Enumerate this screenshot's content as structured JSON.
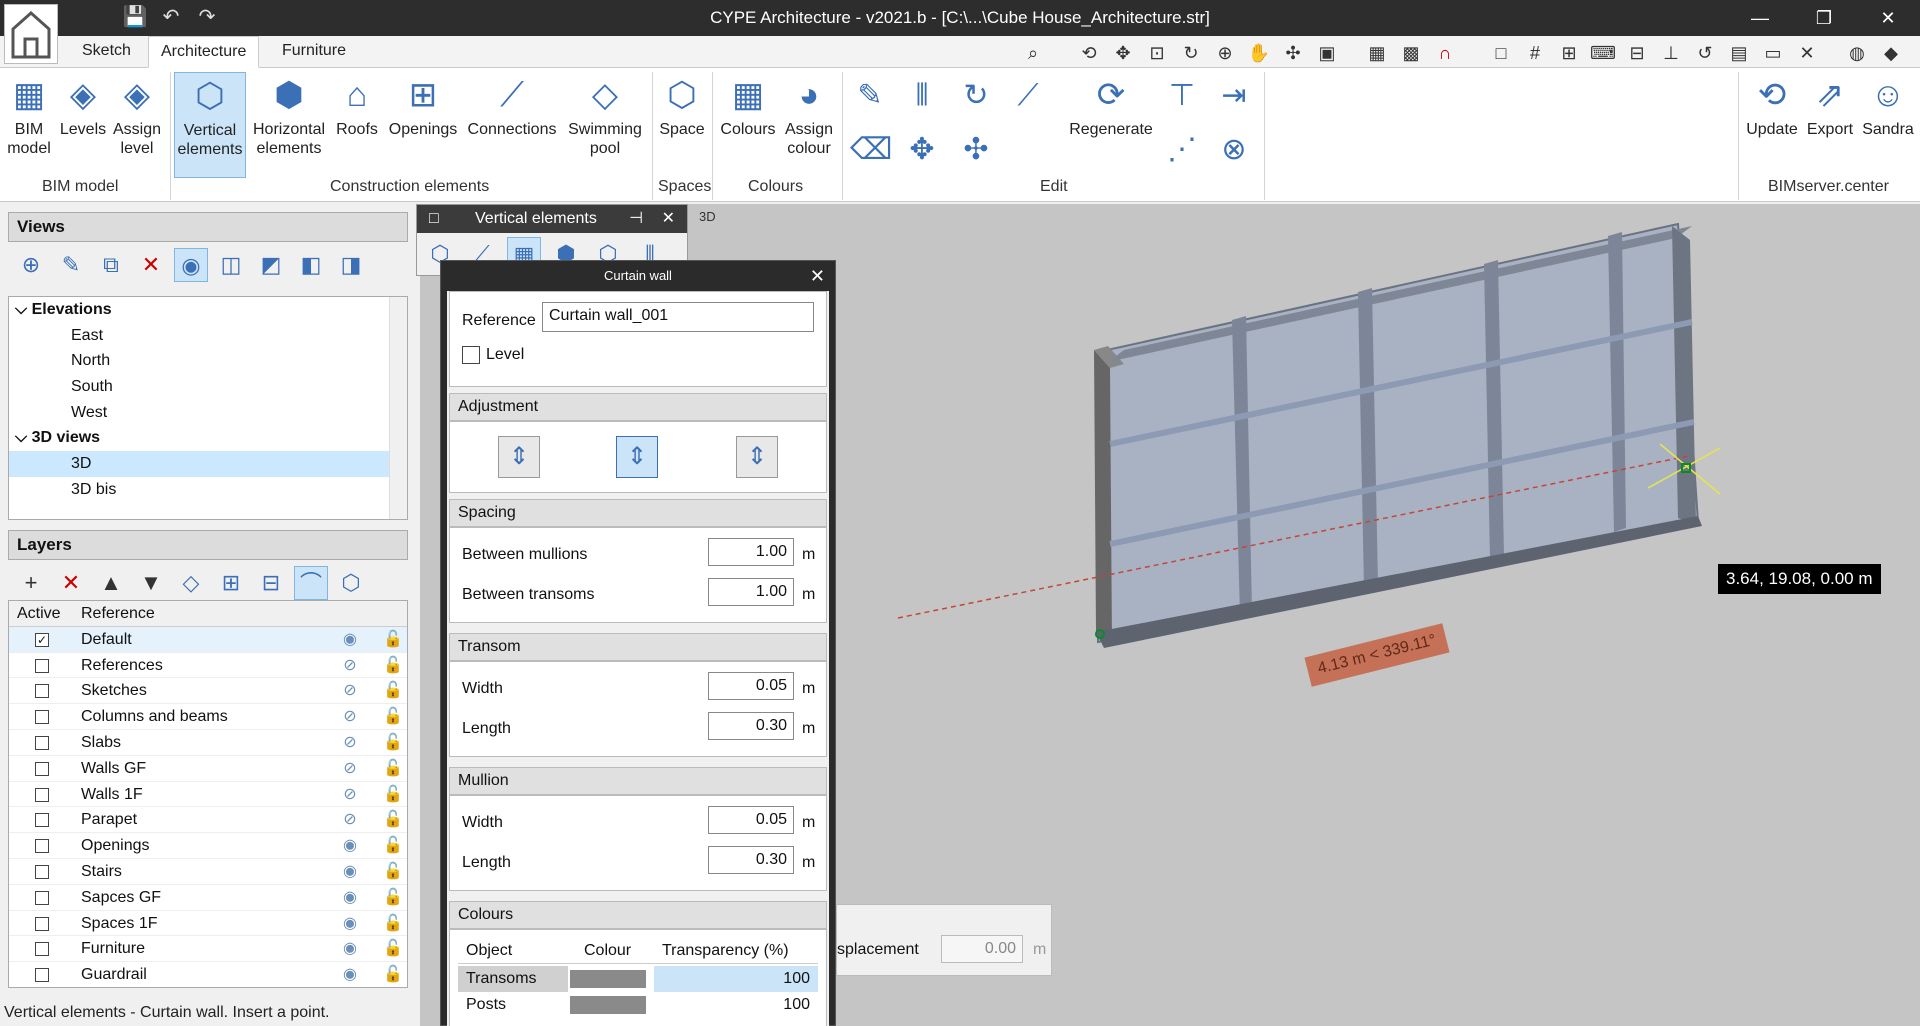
{
  "window": {
    "title": "CYPE Architecture - v2021.b - [C:\\...\\Cube House_Architecture.str]",
    "minimize": "—",
    "restore": "❐",
    "close": "✕"
  },
  "quick_access": {
    "save": "💾",
    "undo": "↶",
    "redo": "↷"
  },
  "ribbon_tabs": [
    "Sketch",
    "Architecture",
    "Furniture"
  ],
  "ribbon_buttons": {
    "bim_model": "BIM\nmodel",
    "levels": "Levels",
    "assign_level": "Assign\nlevel",
    "vertical_elements": "Vertical\nelements",
    "horizontal_elements": "Horizontal\nelements",
    "roofs": "Roofs",
    "openings": "Openings",
    "connections": "Connections",
    "swimming_pool": "Swimming\npool",
    "space": "Space",
    "colours": "Colours",
    "assign_colour": "Assign\ncolour",
    "regenerate": "Regenerate",
    "update": "Update",
    "export": "Export",
    "user": "Sandra"
  },
  "ribbon_groups": {
    "bim": "BIM model",
    "construction": "Construction elements",
    "spaces": "Spaces",
    "colours": "Colours",
    "edit": "Edit",
    "bimserver": "BIMserver.center"
  },
  "views": {
    "header": "Views",
    "tree": [
      {
        "label": "Elevations",
        "type": "group"
      },
      {
        "label": "East",
        "type": "leaf"
      },
      {
        "label": "North",
        "type": "leaf"
      },
      {
        "label": "South",
        "type": "leaf"
      },
      {
        "label": "West",
        "type": "leaf"
      },
      {
        "label": "3D views",
        "type": "group"
      },
      {
        "label": "3D",
        "type": "leaf",
        "selected": true
      },
      {
        "label": "3D bis",
        "type": "leaf"
      }
    ]
  },
  "layers": {
    "header": "Layers",
    "col_active": "Active",
    "col_reference": "Reference",
    "rows": [
      {
        "name": "Default",
        "active": true,
        "visible": true
      },
      {
        "name": "References",
        "active": false,
        "visible": false
      },
      {
        "name": "Sketches",
        "active": false,
        "visible": false
      },
      {
        "name": "Columns and beams",
        "active": false,
        "visible": false
      },
      {
        "name": "Slabs",
        "active": false,
        "visible": false
      },
      {
        "name": "Walls GF",
        "active": false,
        "visible": false
      },
      {
        "name": "Walls 1F",
        "active": false,
        "visible": false
      },
      {
        "name": "Parapet",
        "active": false,
        "visible": false
      },
      {
        "name": "Openings",
        "active": false,
        "visible": true
      },
      {
        "name": "Stairs",
        "active": false,
        "visible": true
      },
      {
        "name": "Sapces GF",
        "active": false,
        "visible": true
      },
      {
        "name": "Spaces 1F",
        "active": false,
        "visible": true
      },
      {
        "name": "Furniture",
        "active": false,
        "visible": true
      },
      {
        "name": "Guardrail",
        "active": false,
        "visible": true
      }
    ]
  },
  "vertical_panel": {
    "title": "Vertical elements"
  },
  "curtain_wall": {
    "title": "Curtain wall",
    "reference_label": "Reference",
    "reference_value": "Curtain wall_001",
    "level_label": "Level",
    "adjustment": "Adjustment",
    "spacing": "Spacing",
    "between_mullions_label": "Between mullions",
    "between_mullions": "1.00",
    "between_transoms_label": "Between transoms",
    "between_transoms": "1.00",
    "transom": "Transom",
    "mullion": "Mullion",
    "width_label": "Width",
    "length_label": "Length",
    "transom_width": "0.05",
    "transom_length": "0.30",
    "mullion_width": "0.05",
    "mullion_length": "0.30",
    "unit": "m",
    "colours": "Colours",
    "col_object": "Object",
    "col_colour": "Colour",
    "col_transparency": "Transparency (%)",
    "colour_rows": [
      {
        "object": "Transoms",
        "transparency": "100"
      },
      {
        "object": "Posts",
        "transparency": "100"
      }
    ]
  },
  "displacement": {
    "label": "splacement",
    "value": "0.00",
    "unit": "m"
  },
  "viewport": {
    "view_badge": "3D",
    "coordinates": "3.64, 19.08, 0.00 m",
    "dimension": "4.13 m < 339.11°"
  },
  "status": "Vertical elements - Curtain wall. Insert a point.",
  "colors": {
    "accent": "#3b6fb6",
    "selection": "#cce4f7",
    "viewport_bg": "#c5c5c5",
    "dimension_label": "#c46a4e"
  }
}
